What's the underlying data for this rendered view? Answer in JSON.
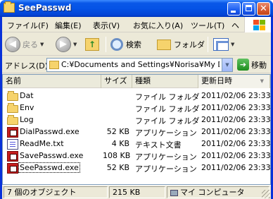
{
  "window": {
    "title": "SeePasswd"
  },
  "menu": {
    "items": [
      "ファイル(F)",
      "編集(E)",
      "表示(V)",
      "お気に入り(A)",
      "ツール(T)",
      "ヘ"
    ]
  },
  "toolbar": {
    "back_label": "戻る",
    "search_label": "検索",
    "folders_label": "フォルダ"
  },
  "address": {
    "label": "アドレス(D)",
    "value": "C:¥Documents and Settings¥Norisa¥My Do",
    "go_label": "移動"
  },
  "columns": [
    {
      "label": "名前"
    },
    {
      "label": "サイズ"
    },
    {
      "label": "種類"
    },
    {
      "label": "更新日時"
    }
  ],
  "files": [
    {
      "name": "Dat",
      "size": "",
      "type": "ファイル フォルダ",
      "modified": "2011/02/06 23:33",
      "icon": "folder-icon"
    },
    {
      "name": "Env",
      "size": "",
      "type": "ファイル フォルダ",
      "modified": "2011/02/06 23:33",
      "icon": "folder-icon"
    },
    {
      "name": "Log",
      "size": "",
      "type": "ファイル フォルダ",
      "modified": "2011/02/06 23:33",
      "icon": "folder-icon"
    },
    {
      "name": "DialPasswd.exe",
      "size": "52 KB",
      "type": "アプリケーション",
      "modified": "2011/02/06 23:33",
      "icon": "application-icon"
    },
    {
      "name": "ReadMe.txt",
      "size": "4 KB",
      "type": "テキスト文書",
      "modified": "2011/02/06 23:33",
      "icon": "text-document-icon"
    },
    {
      "name": "SavePasswd.exe",
      "size": "108 KB",
      "type": "アプリケーション",
      "modified": "2011/02/06 23:33",
      "icon": "application-icon"
    },
    {
      "name": "SeePasswd.exe",
      "size": "52 KB",
      "type": "アプリケーション",
      "modified": "2011/02/06 23:33",
      "icon": "application-icon"
    }
  ],
  "status": {
    "count": "7 個のオブジェクト",
    "size": "215 KB",
    "location": "マイ コンピュータ"
  },
  "colors": {
    "titlebar": "#0553e6",
    "chrome": "#ece9d8",
    "selection_focus": "#000000"
  }
}
